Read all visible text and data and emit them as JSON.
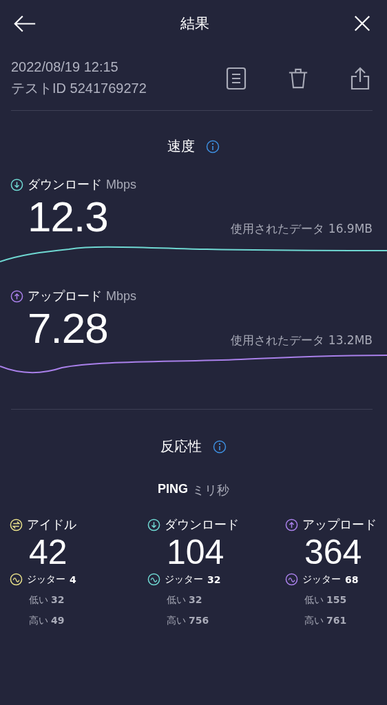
{
  "header": {
    "title": "結果"
  },
  "test": {
    "date": "2022/08/19 12:15",
    "test_id": "テストID 5241769272"
  },
  "speed": {
    "title": "速度",
    "items": [
      {
        "kind": "download",
        "color": "#6fd8d2",
        "label": "ダウンロード",
        "unit": "Mbps",
        "value": "12.3",
        "data_used": "使用されたデータ 16.9MB"
      },
      {
        "kind": "upload",
        "color": "#a980ea",
        "label": "アップロード",
        "unit": "Mbps",
        "value": "7.28",
        "data_used": "使用されたデータ 13.2MB"
      }
    ]
  },
  "responsiveness": {
    "title": "反応性",
    "ping_label": "PING",
    "ping_unit": "ミリ秒",
    "items": [
      {
        "kind": "idle",
        "color": "#e8e08a",
        "label": "アイドル",
        "value": "42",
        "jitter_label": "ジッター",
        "jitter": "4",
        "low_label": "低い",
        "low": "32",
        "high_label": "高い",
        "high": "49"
      },
      {
        "kind": "download",
        "color": "#6fd8d2",
        "label": "ダウンロード",
        "value": "104",
        "jitter_label": "ジッター",
        "jitter": "32",
        "low_label": "低い",
        "low": "32",
        "high_label": "高い",
        "high": "756"
      },
      {
        "kind": "upload",
        "color": "#a980ea",
        "label": "アップロード",
        "value": "364",
        "jitter_label": "ジッター",
        "jitter": "68",
        "low_label": "低い",
        "low": "155",
        "high_label": "高い",
        "high": "761"
      }
    ]
  }
}
